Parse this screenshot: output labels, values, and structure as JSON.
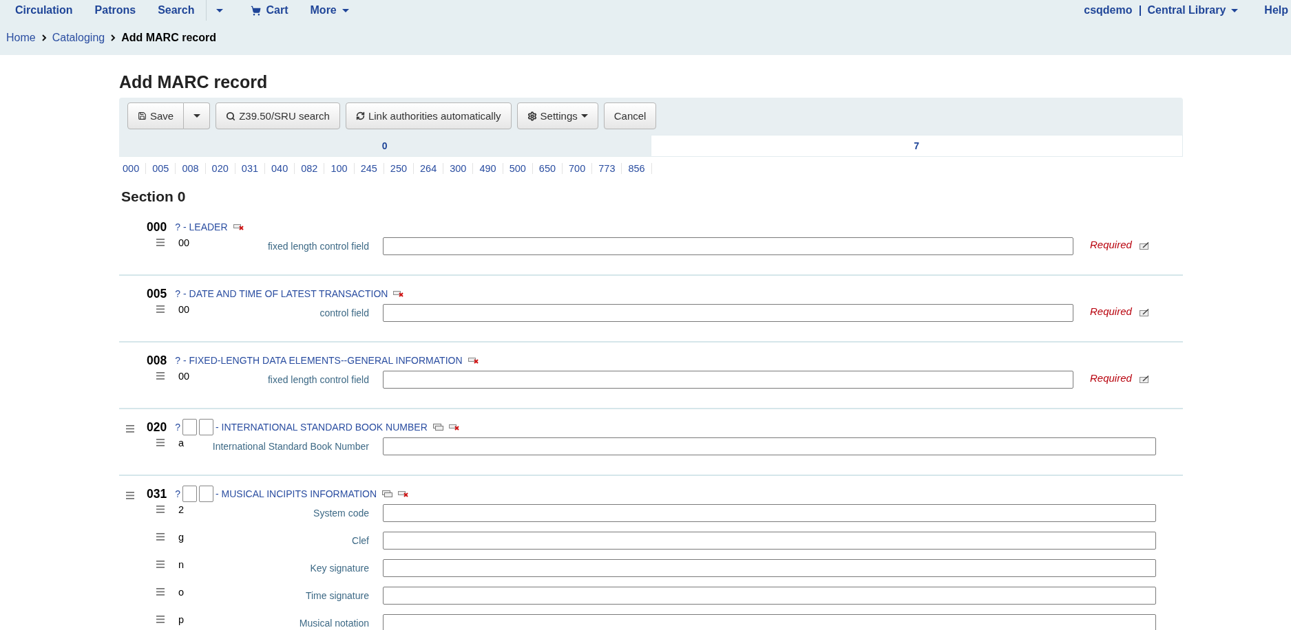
{
  "top_nav": {
    "items": [
      {
        "label": "Circulation",
        "kind": "link"
      },
      {
        "label": "Patrons",
        "kind": "link"
      },
      {
        "label": "Search",
        "kind": "link"
      },
      {
        "kind": "caret"
      },
      {
        "label": "Cart",
        "kind": "cart"
      },
      {
        "label": "More",
        "kind": "dropdown"
      }
    ],
    "user": "csqdemo",
    "library": "Central Library",
    "help": "Help"
  },
  "breadcrumbs": [
    {
      "label": "Home",
      "current": false
    },
    {
      "label": "Cataloging",
      "current": false
    },
    {
      "label": "Add MARC record",
      "current": true
    }
  ],
  "page_title": "Add MARC record",
  "toolbar": [
    {
      "label": "Save",
      "kind": "save"
    },
    {
      "label": "Z39.50/SRU search",
      "kind": "search"
    },
    {
      "label": "Link authorities automatically",
      "kind": "refresh"
    },
    {
      "label": "Settings",
      "kind": "settings"
    },
    {
      "label": "Cancel",
      "kind": "plain"
    }
  ],
  "tabs": [
    {
      "label": "0",
      "selected": true
    },
    {
      "label": "7",
      "selected": false
    }
  ],
  "tag_links": [
    "000",
    "005",
    "008",
    "020",
    "031",
    "040",
    "082",
    "100",
    "245",
    "250",
    "264",
    "300",
    "490",
    "500",
    "650",
    "700",
    "773",
    "856"
  ],
  "section_title": "Section 0",
  "fields": [
    {
      "tag": "000",
      "kind": "control",
      "help": "?",
      "name": "- LEADER",
      "subfields": [
        {
          "code": "00",
          "label": "fixed length control field",
          "note": "Required"
        }
      ]
    },
    {
      "tag": "005",
      "kind": "control",
      "help": "?",
      "name": "- DATE AND TIME OF LATEST TRANSACTION",
      "subfields": [
        {
          "code": "00",
          "label": "control field",
          "note": "Required"
        }
      ]
    },
    {
      "tag": "008",
      "kind": "control",
      "help": "?",
      "name": "- FIXED-LENGTH DATA ELEMENTS--GENERAL INFORMATION",
      "subfields": [
        {
          "code": "00",
          "label": "fixed length control field",
          "note": "Required"
        }
      ]
    },
    {
      "tag": "020",
      "kind": "data",
      "help": "?",
      "name": "- INTERNATIONAL STANDARD BOOK NUMBER",
      "subfields": [
        {
          "code": "a",
          "label": "International Standard Book Number"
        }
      ]
    },
    {
      "tag": "031",
      "kind": "data",
      "help": "?",
      "name": "- MUSICAL INCIPITS INFORMATION",
      "subfields": [
        {
          "code": "2",
          "label": "System code"
        },
        {
          "code": "g",
          "label": "Clef"
        },
        {
          "code": "n",
          "label": "Key signature"
        },
        {
          "code": "o",
          "label": "Time signature"
        },
        {
          "code": "p",
          "label": "Musical notation"
        }
      ]
    }
  ]
}
